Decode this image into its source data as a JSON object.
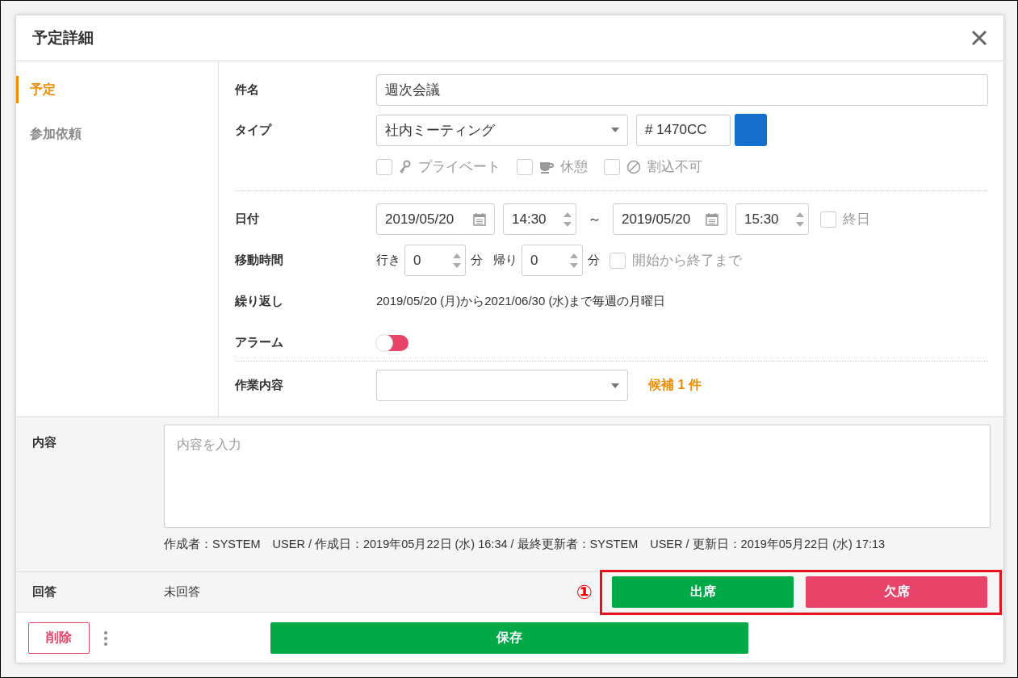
{
  "dialog": {
    "title": "予定詳細"
  },
  "sidebar": {
    "items": [
      {
        "label": "予定",
        "selected": true
      },
      {
        "label": "参加依頼",
        "selected": false
      }
    ]
  },
  "form": {
    "subject": {
      "label": "件名",
      "value": "週次会議"
    },
    "type": {
      "label": "タイプ",
      "value": "社内ミーティング",
      "color_code": "# 1470CC",
      "color": "#1470cc"
    },
    "flags": [
      {
        "label": "プライベート",
        "kind": "key",
        "checked": false
      },
      {
        "label": "休憩",
        "kind": "cup",
        "checked": false
      },
      {
        "label": "割込不可",
        "kind": "ban",
        "checked": false
      }
    ],
    "date": {
      "label": "日付",
      "start_date": "2019/05/20",
      "start_time": "14:30",
      "separator": "～",
      "end_date": "2019/05/20",
      "end_time": "15:30",
      "all_day": {
        "label": "終日",
        "checked": false
      }
    },
    "travel": {
      "label": "移動時間",
      "go_label": "行き",
      "go_value": "0",
      "go_unit": "分",
      "return_label": "帰り",
      "return_value": "0",
      "return_unit": "分",
      "whole": {
        "label": "開始から終了まで",
        "checked": false
      }
    },
    "repeat": {
      "label": "繰り返し",
      "text": "2019/05/20 (月)から2021/06/30 (水)まで毎週の月曜日"
    },
    "alarm": {
      "label": "アラーム",
      "on": false
    },
    "work": {
      "label": "作業内容",
      "candidates": "候補 1 件"
    }
  },
  "content": {
    "label": "内容",
    "placeholder": "内容を入力",
    "meta": "作成者：SYSTEM　USER / 作成日：2019年05月22日 (水) 16:34 / 最終更新者：SYSTEM　USER / 更新日：2019年05月22日 (水) 17:13"
  },
  "answer": {
    "label": "回答",
    "status": "未回答",
    "buttons": [
      {
        "label": "出席",
        "kind": "accept"
      },
      {
        "label": "欠席",
        "kind": "decline"
      }
    ]
  },
  "annotation": {
    "label": "①"
  },
  "footer": {
    "delete": "削除",
    "save": "保存"
  }
}
